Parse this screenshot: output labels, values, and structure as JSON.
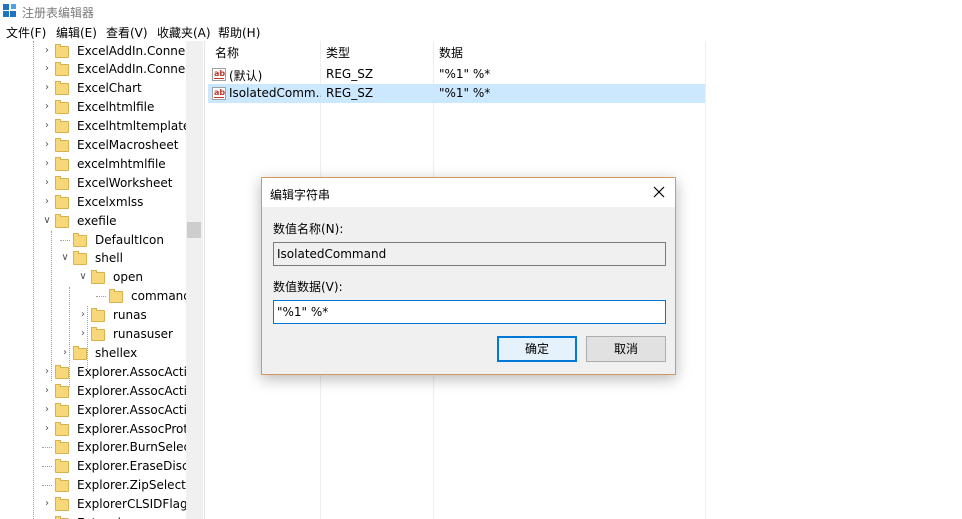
{
  "app": {
    "title": "注册表编辑器"
  },
  "menu": [
    {
      "label": "文件(F)"
    },
    {
      "label": "编辑(E)"
    },
    {
      "label": "查看(V)"
    },
    {
      "label": "收藏夹(A)"
    },
    {
      "label": "帮助(H)"
    }
  ],
  "tree": [
    {
      "label": "ExcelAddIn.Connect",
      "level": 0,
      "expanded": false
    },
    {
      "label": "ExcelAddIn.Connect",
      "level": 0,
      "expanded": false
    },
    {
      "label": "ExcelChart",
      "level": 0,
      "expanded": false
    },
    {
      "label": "Excelhtmlfile",
      "level": 0,
      "expanded": false
    },
    {
      "label": "Excelhtmltemplate",
      "level": 0,
      "expanded": false
    },
    {
      "label": "ExcelMacrosheet",
      "level": 0,
      "expanded": false
    },
    {
      "label": "excelmhtmlfile",
      "level": 0,
      "expanded": false
    },
    {
      "label": "ExcelWorksheet",
      "level": 0,
      "expanded": false
    },
    {
      "label": "Excelxmlss",
      "level": 0,
      "expanded": false
    },
    {
      "label": "exefile",
      "level": 0,
      "expanded": true
    },
    {
      "label": "DefaultIcon",
      "level": 1,
      "expanded": null
    },
    {
      "label": "shell",
      "level": 1,
      "expanded": true
    },
    {
      "label": "open",
      "level": 2,
      "expanded": true
    },
    {
      "label": "command",
      "level": 3,
      "expanded": null,
      "selected": true
    },
    {
      "label": "runas",
      "level": 2,
      "expanded": false
    },
    {
      "label": "runasuser",
      "level": 2,
      "expanded": false
    },
    {
      "label": "shellex",
      "level": 1,
      "expanded": false
    },
    {
      "label": "Explorer.AssocActio",
      "level": 0,
      "expanded": false
    },
    {
      "label": "Explorer.AssocActio",
      "level": 0,
      "expanded": false
    },
    {
      "label": "Explorer.AssocActio",
      "level": 0,
      "expanded": false
    },
    {
      "label": "Explorer.AssocProto",
      "level": 0,
      "expanded": false
    },
    {
      "label": "Explorer.BurnSelect",
      "level": 0,
      "expanded": null
    },
    {
      "label": "Explorer.EraseDisc",
      "level": 0,
      "expanded": null
    },
    {
      "label": "Explorer.ZipSelectio",
      "level": 0,
      "expanded": null
    },
    {
      "label": "ExplorerCLSIDFlags",
      "level": 0,
      "expanded": false
    },
    {
      "label": "Extensions",
      "level": 0,
      "expanded": false
    }
  ],
  "list": {
    "headers": {
      "name": "名称",
      "type": "类型",
      "data": "数据"
    },
    "rows": [
      {
        "name": "(默认)",
        "type": "REG_SZ",
        "data": "\"%1\" %*",
        "icon": "string-value-icon"
      },
      {
        "name": "IsolatedComm...",
        "type": "REG_SZ",
        "data": "\"%1\" %*",
        "icon": "string-value-icon",
        "selected": true
      }
    ]
  },
  "dialog": {
    "title": "编辑字符串",
    "name_label": "数值名称(N):",
    "name_value": "IsolatedCommand",
    "data_label": "数值数据(V):",
    "data_value": "\"%1\" %*",
    "ok_label": "确定",
    "cancel_label": "取消"
  }
}
